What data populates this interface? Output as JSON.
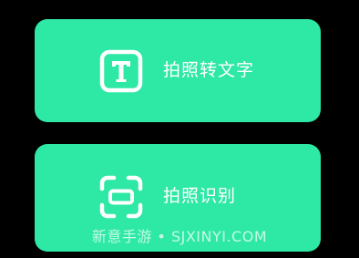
{
  "colors": {
    "background": "#000000",
    "card": "#2ee8a6",
    "foreground": "#ffffff"
  },
  "actions": [
    {
      "label": "拍照转文字",
      "icon": "text-recognition-icon"
    },
    {
      "label": "拍照识别",
      "icon": "scan-frame-icon"
    }
  ],
  "watermark": "新意手游 • SJXINYI.COM"
}
